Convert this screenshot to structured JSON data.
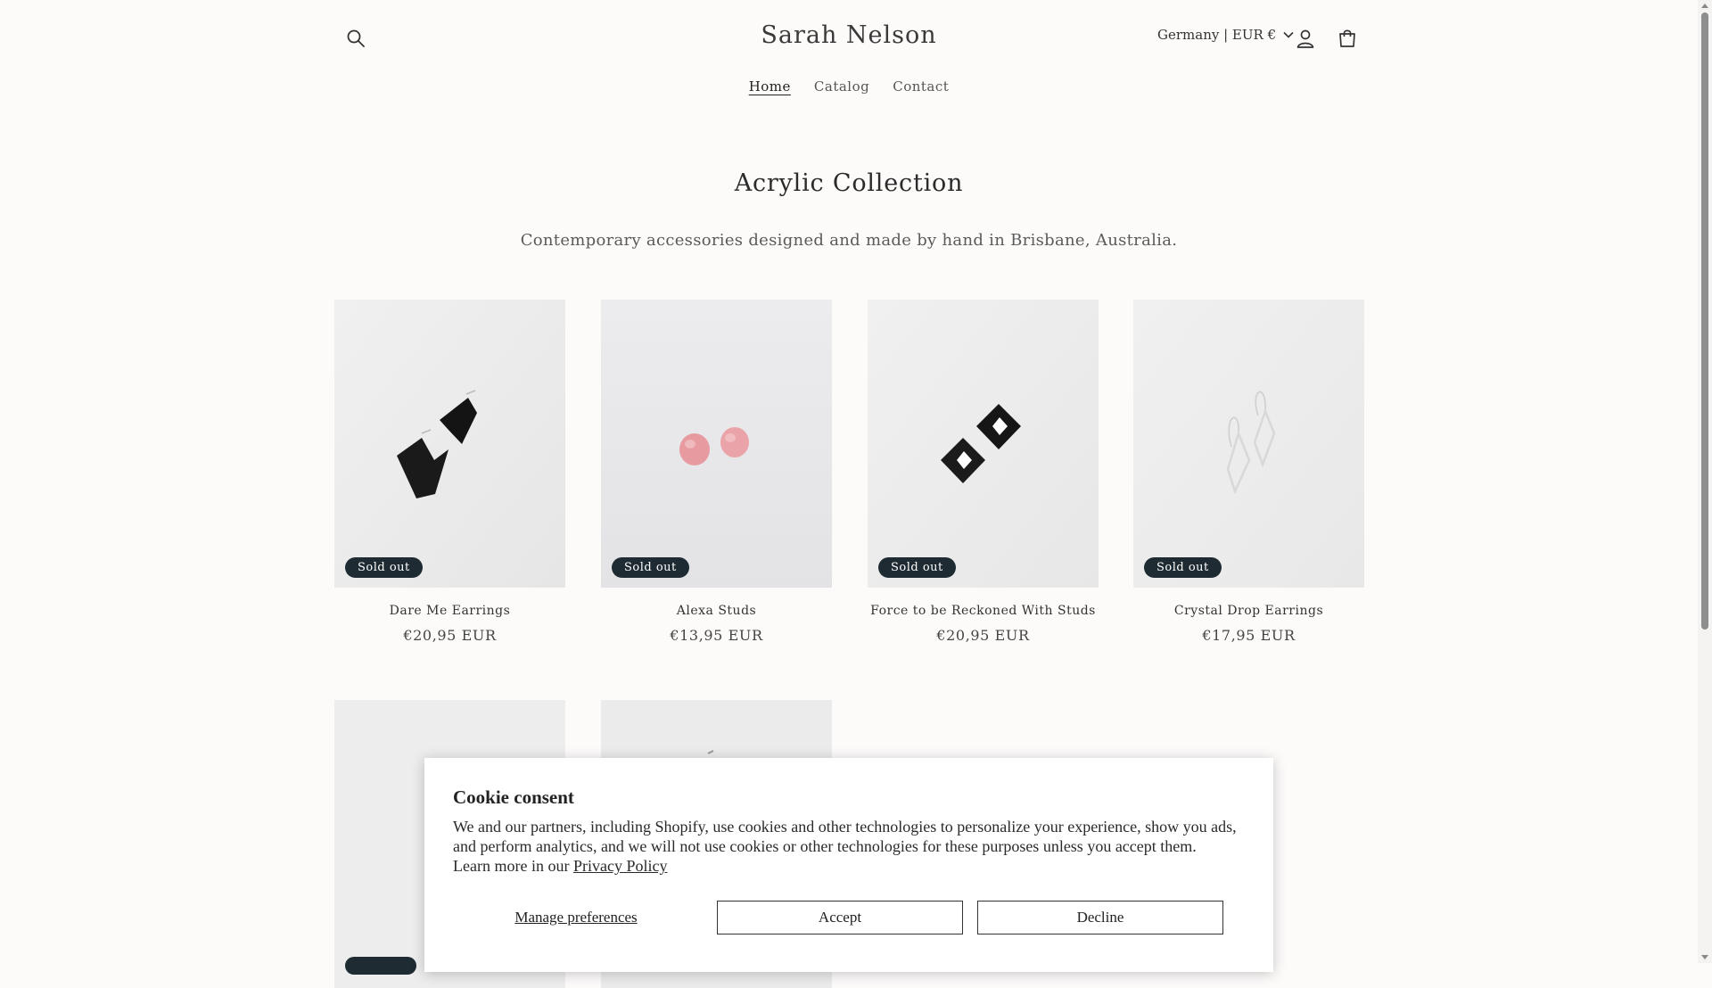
{
  "header": {
    "brand": "Sarah Nelson",
    "locale_label": "Germany | EUR €",
    "search_icon": "search-icon",
    "account_icon": "account-icon",
    "cart_icon": "cart-icon"
  },
  "nav": {
    "items": [
      {
        "label": "Home",
        "active": true
      },
      {
        "label": "Catalog",
        "active": false
      },
      {
        "label": "Contact",
        "active": false
      }
    ]
  },
  "collection": {
    "title": "Acrylic Collection",
    "description": "Contemporary accessories designed and made by hand in Brisbane, Australia."
  },
  "products": [
    {
      "name": "Dare Me Earrings",
      "price": "€20,95 EUR",
      "badge": "Sold out"
    },
    {
      "name": "Alexa Studs",
      "price": "€13,95 EUR",
      "badge": "Sold out"
    },
    {
      "name": "Force to be Reckoned With Studs",
      "price": "€20,95 EUR",
      "badge": "Sold out"
    },
    {
      "name": "Crystal Drop Earrings",
      "price": "€17,95 EUR",
      "badge": "Sold out"
    }
  ],
  "cookie": {
    "title": "Cookie consent",
    "body": "We and our partners, including Shopify, use cookies and other technologies to personalize your experience, show you ads, and perform analytics, and we will not use cookies or other technologies for these purposes unless you accept them. Learn more in our ",
    "policy_link": "Privacy Policy",
    "manage_label": "Manage preferences",
    "accept_label": "Accept",
    "decline_label": "Decline"
  },
  "colors": {
    "page_background": "#fdfbfa",
    "badge_background": "#1e2b33",
    "text": "#2b2b2b"
  }
}
